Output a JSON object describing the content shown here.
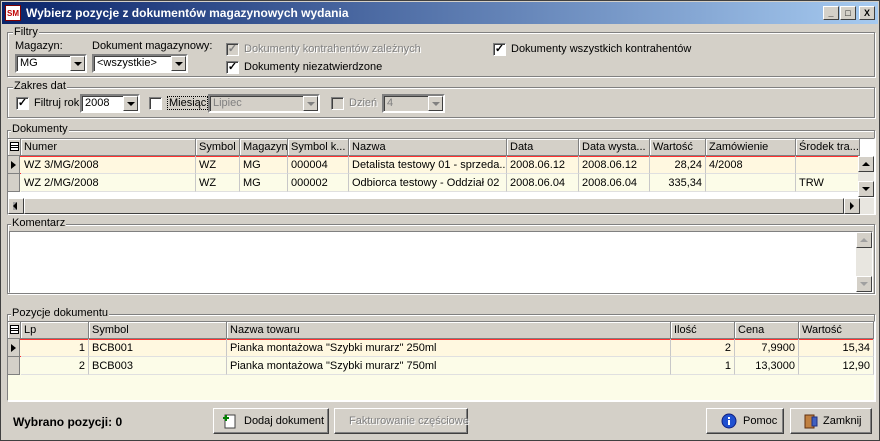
{
  "window": {
    "title": "Wybierz pozycje z dokumentów magazynowych wydania",
    "app_icon": "SM",
    "minimize": "_",
    "maximize": "□",
    "close": "X"
  },
  "filters": {
    "group_label": "Filtry",
    "magazyn_label": "Magazyn:",
    "magazyn_value": "MG",
    "dokument_label": "Dokument magazynowy:",
    "dokument_value": "<wszystkie>",
    "dok_zaleznych_label": "Dokumenty kontrahentów zależnych",
    "dok_niezatw_label": "Dokumenty niezatwierdzone",
    "dok_wszystkich_label": "Dokumenty wszystkich kontrahentów"
  },
  "dates": {
    "group_label": "Zakres dat",
    "filtruj_rok_label": "Filtruj rok",
    "rok_value": "2008",
    "miesiac_label": "Miesiąc",
    "miesiac_value": "Lipiec",
    "dzien_label": "Dzień",
    "dzien_value": "4"
  },
  "dokumenty": {
    "group_label": "Dokumenty",
    "columns": [
      "Numer",
      "Symbol",
      "Magazyn",
      "Symbol k...",
      "Nazwa",
      "Data",
      "Data wysta...",
      "Wartość",
      "Zamówienie",
      "Środek tra..."
    ],
    "rows": [
      [
        "WZ  3/MG/2008",
        "WZ",
        "MG",
        "000004",
        "Detalista testowy 01 - sprzeda...",
        "2008.06.12",
        "2008.06.12",
        "28,24",
        "4/2008",
        ""
      ],
      [
        "WZ  2/MG/2008",
        "WZ",
        "MG",
        "000002",
        "Odbiorca testowy - Oddział 02",
        "2008.06.04",
        "2008.06.04",
        "335,34",
        "",
        "TRW"
      ]
    ]
  },
  "komentarz": {
    "group_label": "Komentarz"
  },
  "pozycje": {
    "group_label": "Pozycje dokumentu",
    "columns": [
      "Lp",
      "Symbol",
      "Nazwa towaru",
      "Ilość",
      "Cena",
      "Wartość"
    ],
    "rows": [
      [
        "1",
        "BCB001",
        "Pianka montażowa \"Szybki murarz\" 250ml",
        "2",
        "7,9900",
        "15,34"
      ],
      [
        "2",
        "BCB003",
        "Pianka montażowa \"Szybki murarz\" 750ml",
        "1",
        "13,3000",
        "12,90"
      ]
    ]
  },
  "footer": {
    "selected_label": "Wybrano pozycji: 0",
    "add_button": "Dodaj dokument",
    "partial_button": "Fakturowanie częściowe",
    "help_button": "Pomoc",
    "close_button": "Zamknij"
  },
  "colors": {
    "title_start": "#0a246a",
    "title_end": "#a6caf0",
    "row_selected": "#fff8e0",
    "row_alt": "#fcfce8",
    "selection_border": "#ff3030"
  }
}
